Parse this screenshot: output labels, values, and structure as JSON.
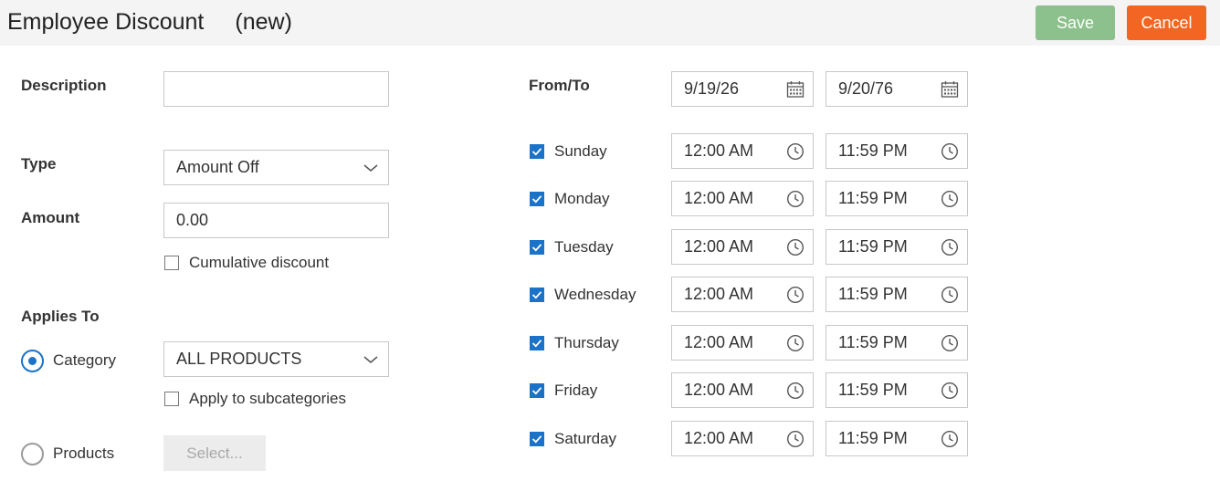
{
  "header": {
    "title": "Employee Discount",
    "status": "(new)",
    "save_label": "Save",
    "cancel_label": "Cancel"
  },
  "form": {
    "description": {
      "label": "Description",
      "value": ""
    },
    "type": {
      "label": "Type",
      "value": "Amount Off"
    },
    "amount": {
      "label": "Amount",
      "value": "0.00"
    },
    "cumulative": {
      "label": "Cumulative discount",
      "checked": false
    },
    "applies_to": {
      "label": "Applies To",
      "category": {
        "label": "Category",
        "selected": true,
        "value": "ALL PRODUCTS"
      },
      "subcategories": {
        "label": "Apply to subcategories",
        "checked": false
      },
      "products": {
        "label": "Products",
        "selected": false,
        "button_label": "Select..."
      }
    }
  },
  "schedule": {
    "from_to_label": "From/To",
    "from": "9/19/26",
    "to": "9/20/76",
    "days": [
      {
        "name": "Sunday",
        "checked": true,
        "start": "12:00 AM",
        "end": "11:59 PM"
      },
      {
        "name": "Monday",
        "checked": true,
        "start": "12:00 AM",
        "end": "11:59 PM"
      },
      {
        "name": "Tuesday",
        "checked": true,
        "start": "12:00 AM",
        "end": "11:59 PM"
      },
      {
        "name": "Wednesday",
        "checked": true,
        "start": "12:00 AM",
        "end": "11:59 PM"
      },
      {
        "name": "Thursday",
        "checked": true,
        "start": "12:00 AM",
        "end": "11:59 PM"
      },
      {
        "name": "Friday",
        "checked": true,
        "start": "12:00 AM",
        "end": "11:59 PM"
      },
      {
        "name": "Saturday",
        "checked": true,
        "start": "12:00 AM",
        "end": "11:59 PM"
      }
    ]
  },
  "colors": {
    "save": "#8cc08c",
    "cancel": "#f26522",
    "accent": "#1a73c8"
  }
}
